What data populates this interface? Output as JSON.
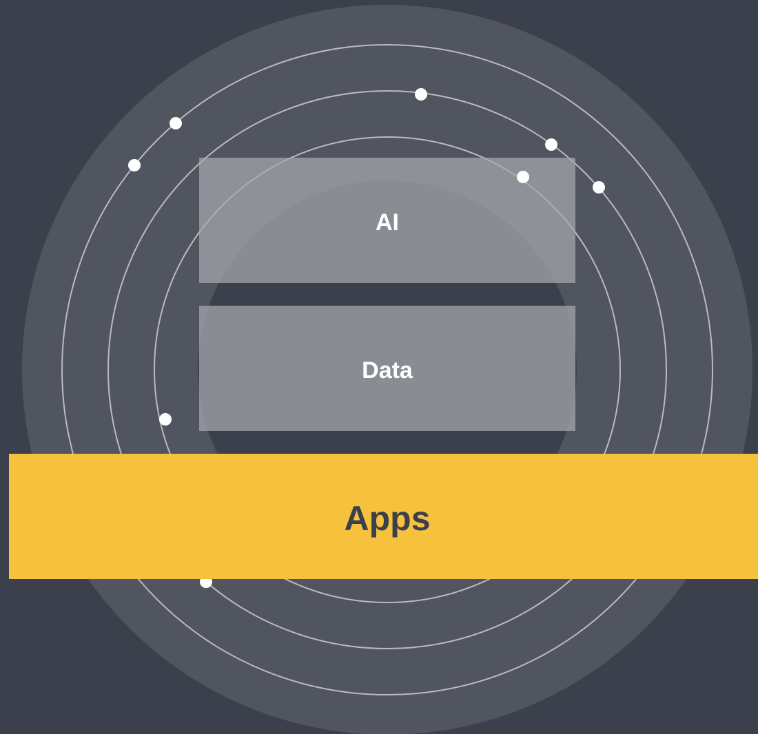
{
  "layers": {
    "ai": {
      "label": "AI"
    },
    "data": {
      "label": "Data"
    },
    "apps": {
      "label": "Apps"
    }
  },
  "colors": {
    "background": "#3b404c",
    "outer_disc": "#515560",
    "inner_disc": "#3b404c",
    "rings": "#b8bbc2",
    "box_fill": "#a7a9ae",
    "apps_band": "#f6c13d",
    "apps_text": "#3b404c",
    "dots": "#ffffff"
  }
}
